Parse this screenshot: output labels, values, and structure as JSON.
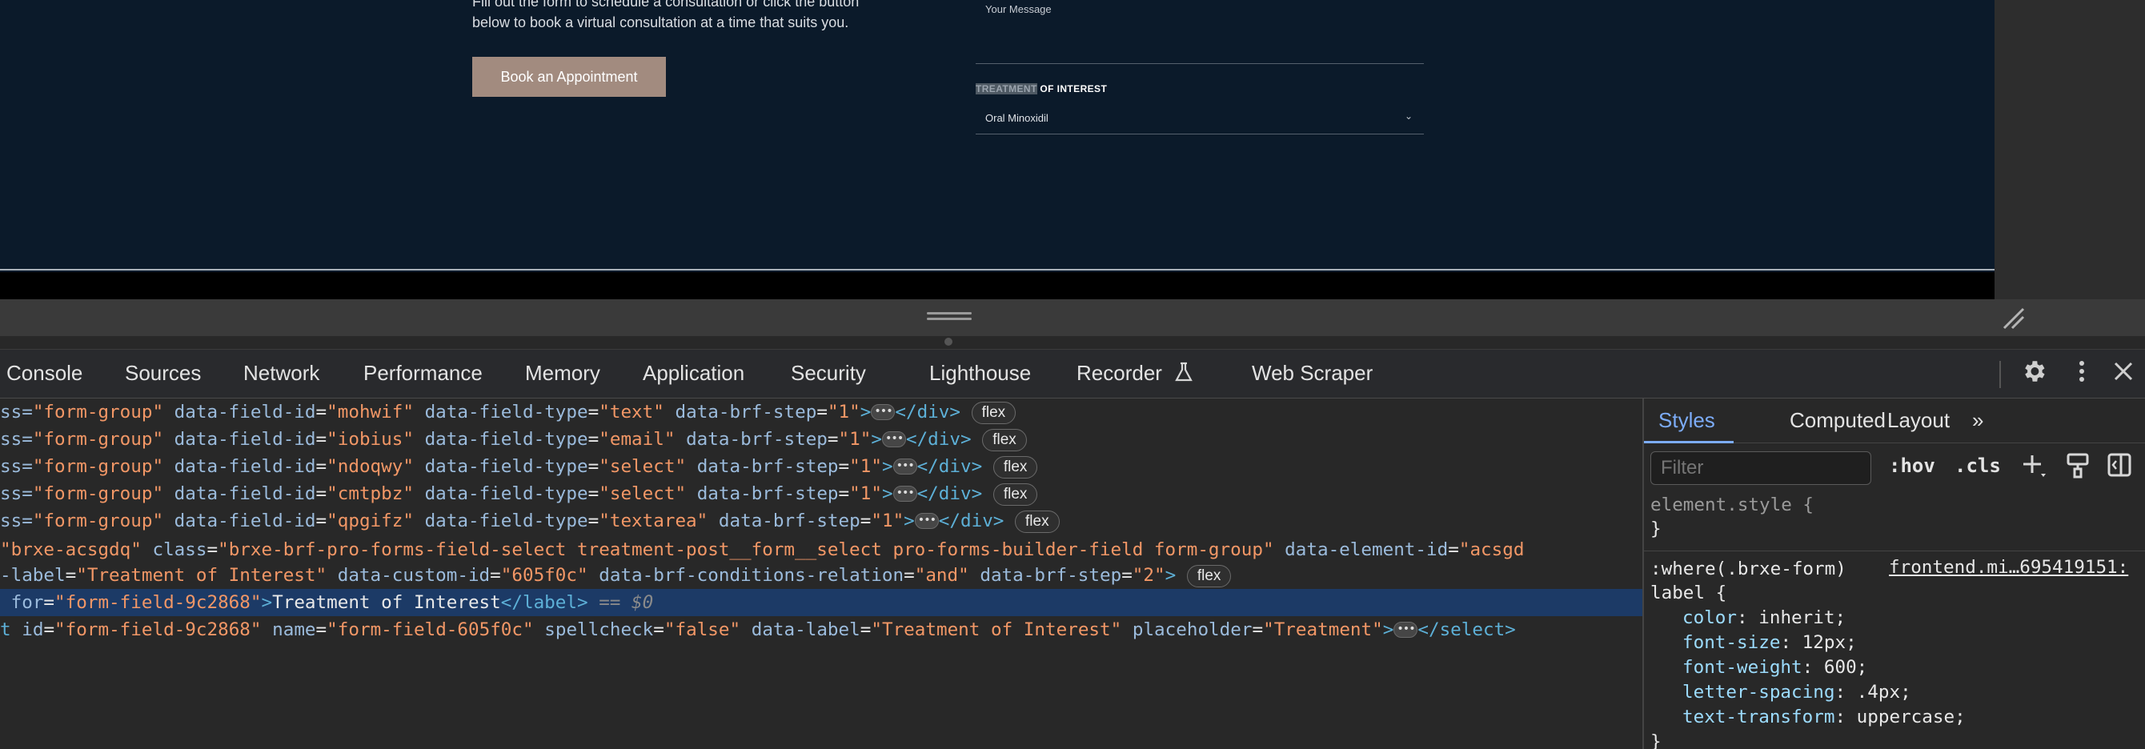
{
  "website": {
    "intro_line_cut": "Fill out the form to schedule a consultation or click the button",
    "intro_line2": "below to book a virtual consultation at a time that suits you.",
    "book_button": "Book an Appointment",
    "message_placeholder": "Your Message",
    "toi_highlight": "TREATMENT",
    "toi_rest": " OF INTEREST",
    "select_value": "Oral Minoxidil",
    "chevron": "⌄"
  },
  "devtools": {
    "tabs": [
      "Console",
      "Sources",
      "Network",
      "Performance",
      "Memory",
      "Application",
      "Security",
      "Lighthouse",
      "Recorder",
      "Web Scraper"
    ],
    "recorder_icon": "flask-icon",
    "toolbar_icons": [
      "settings-gear-icon",
      "more-vertical-icon",
      "close-icon"
    ]
  },
  "elements": {
    "lines": [
      {
        "a": "ss=",
        "cls": "form-group",
        "id": "mohwif",
        "type": "text",
        "step": "1",
        "badge": "flex"
      },
      {
        "a": "ss=",
        "cls": "form-group",
        "id": "iobius",
        "type": "email",
        "step": "1",
        "badge": "flex"
      },
      {
        "a": "ss=",
        "cls": "form-group",
        "id": "ndoqwy",
        "type": "select",
        "step": "1",
        "badge": "flex"
      },
      {
        "a": "ss=",
        "cls": "form-group",
        "id": "cmtpbz",
        "type": "select",
        "step": "1",
        "badge": "flex"
      },
      {
        "a": "ss=",
        "cls": "form-group",
        "id": "qpgifz",
        "type": "textarea",
        "step": "1",
        "badge": "flex"
      }
    ],
    "line6_id": "brxe-acsgdq",
    "line6_class": "brxe-brf-pro-forms-field-select treatment-post__form__select pro-forms-builder-field form-group",
    "line6_elem_attr": "data-element-id",
    "line6_elem_val": "acsgd",
    "line7_label": "Treatment of Interest",
    "line7_custom_id": "605f0c",
    "line7_relation": "and",
    "line7_step": "2",
    "line8_for": "form-field-9c2868",
    "line8_text": "Treatment of Interest",
    "line8_eq": "== $0",
    "line9_id": "form-field-9c2868",
    "line9_name": "form-field-605f0c",
    "line9_spellcheck": "false",
    "line9_label": "Treatment of Interest",
    "line9_placeholder": "Treatment",
    "badge_flex": "flex"
  },
  "styles_pane": {
    "tabs": [
      "Styles",
      "Computed",
      "Layout"
    ],
    "more": "»",
    "filter_placeholder": "Filter",
    "hov": ":hov",
    "cls": ".cls",
    "element_style": "element.style {",
    "close_brace": "}",
    "rule_selector": ":where(.brxe-form)",
    "rule_selector2": "label {",
    "rule_source": "frontend.mi…695419151:",
    "declarations": [
      {
        "prop": "color",
        "val": "inherit;"
      },
      {
        "prop": "font-size",
        "val": "12px;"
      },
      {
        "prop": "font-weight",
        "val": "600;"
      },
      {
        "prop": "letter-spacing",
        "val": ".4px;"
      },
      {
        "prop": "text-transform",
        "val": "uppercase;"
      }
    ]
  }
}
